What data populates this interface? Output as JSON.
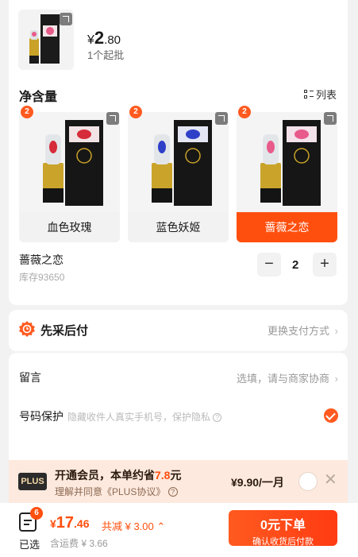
{
  "product": {
    "price_symbol": "¥",
    "price_int": "2",
    "price_dec": ".80",
    "moq": "1个起批"
  },
  "variants": {
    "title": "净含量",
    "list_label": "列表",
    "items": [
      {
        "label": "血色玫瑰",
        "count": "2",
        "accent": "#d62b3a"
      },
      {
        "label": "蓝色妖姬",
        "count": "2",
        "accent": "#2e3fc8"
      },
      {
        "label": "蔷薇之恋",
        "count": "2",
        "accent": "#e85a8a"
      }
    ],
    "selected_name": "蔷薇之恋",
    "stock": "库存93650",
    "quantity": "2",
    "minus": "−",
    "plus": "+"
  },
  "payment": {
    "title": "先采后付",
    "action": "更换支付方式"
  },
  "message": {
    "label": "留言",
    "placeholder": "选填，请与商家协商"
  },
  "privacy": {
    "label": "号码保护",
    "hint": "隐藏收件人真实手机号，保护隐私"
  },
  "plus": {
    "logo": "PLUS",
    "main_prefix": "开通会员，本单约省",
    "main_amount": "7.8",
    "main_suffix": "元",
    "sub": "理解并同意《PLUS协议》",
    "price": "¥9.90/一月"
  },
  "footer": {
    "cart_count": "6",
    "selected_label": "已选",
    "total_symbol": "¥",
    "total_int": "17",
    "total_dec": ".46",
    "discount": "共减 ¥ 3.00",
    "shipping": "含运费 ¥ 3.66",
    "order_title": "0元下单",
    "order_sub": "确认收货后付款"
  },
  "colors": {
    "accent": "#ff4f0e",
    "plus_bg": "#fde9de"
  }
}
